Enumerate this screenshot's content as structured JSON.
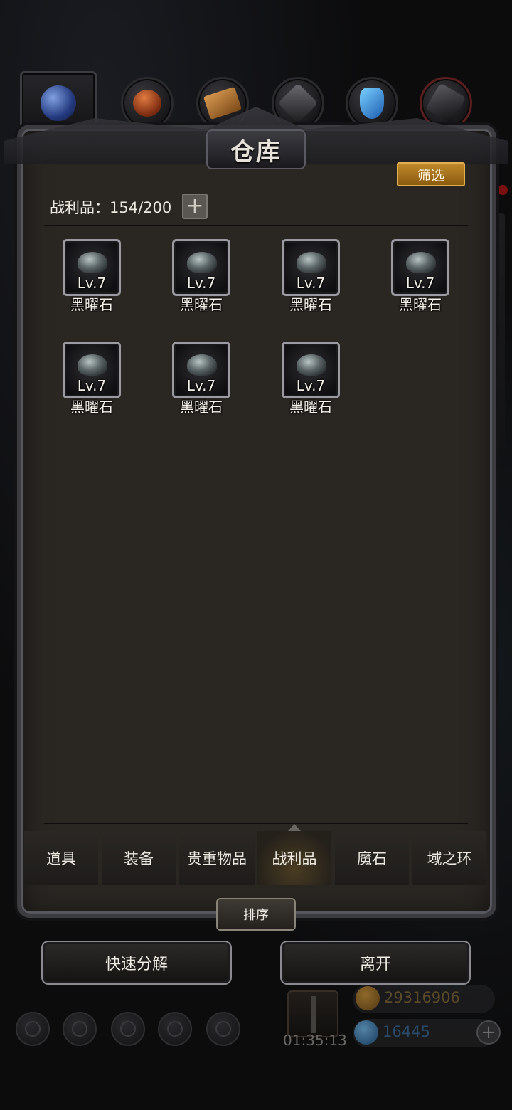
{
  "window": {
    "title": "仓库"
  },
  "filter_button": {
    "label": "筛选"
  },
  "capacity": {
    "label": "战利品：154/200",
    "add_symbol": "+"
  },
  "items": [
    {
      "level": "Lv.7",
      "name": "黑曜石"
    },
    {
      "level": "Lv.7",
      "name": "黑曜石"
    },
    {
      "level": "Lv.7",
      "name": "黑曜石"
    },
    {
      "level": "Lv.7",
      "name": "黑曜石"
    },
    {
      "level": "Lv.7",
      "name": "黑曜石"
    },
    {
      "level": "Lv.7",
      "name": "黑曜石"
    },
    {
      "level": "Lv.7",
      "name": "黑曜石"
    }
  ],
  "category_tabs": [
    {
      "label": "道具"
    },
    {
      "label": "装备"
    },
    {
      "label": "贵重物品"
    },
    {
      "label": "战利品",
      "active": true
    },
    {
      "label": "魔石"
    },
    {
      "label": "域之环"
    }
  ],
  "sort_button": {
    "label": "排序"
  },
  "actions": {
    "quick_decompose": "快速分解",
    "leave": "离开"
  },
  "hud": {
    "timer": "01:35:13",
    "gold": "29316906",
    "gems": "16445",
    "add_symbol": "+"
  },
  "top_tab_icons": [
    "orb-icon",
    "helmet-icon",
    "scroll-icon",
    "stone-icon",
    "crystal-icon",
    "dark-stone-icon"
  ],
  "colors": {
    "accent_gold": "#c08a2a",
    "panel_bg": "#2a2723",
    "text": "#ece8e0"
  }
}
